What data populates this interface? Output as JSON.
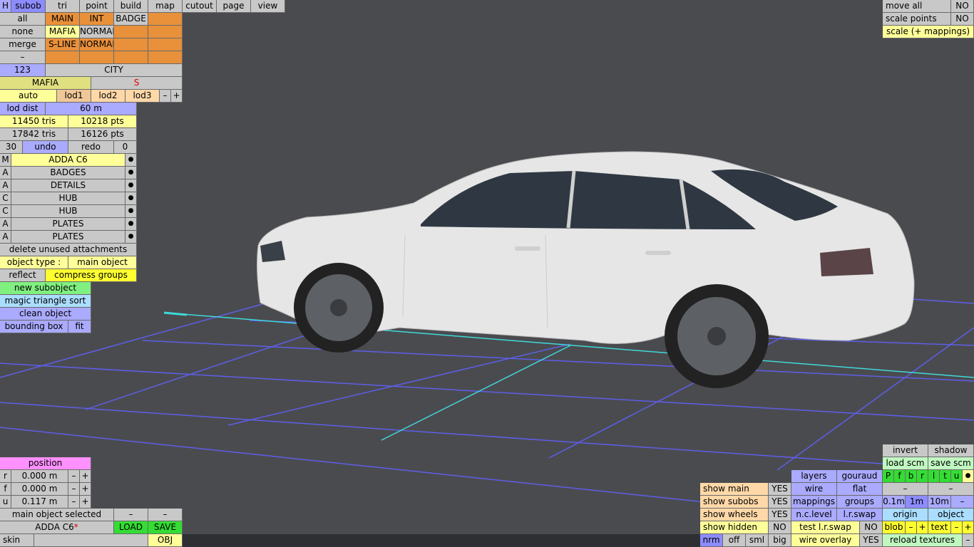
{
  "top_menu": [
    "H",
    "subob",
    "tri",
    "point",
    "build",
    "map",
    "cutout",
    "page",
    "view"
  ],
  "variants": {
    "row1": [
      "all",
      "MAIN",
      "INT",
      "BADGE"
    ],
    "row2": [
      "none",
      "MAFIA",
      "NORMAL"
    ],
    "row3": [
      "merge",
      "S-LINE",
      "NORMAL"
    ],
    "row4": [
      "–"
    ]
  },
  "number_row": {
    "num": "123",
    "name": "CITY"
  },
  "mafia_row": {
    "left": "MAFIA",
    "right": "S"
  },
  "lod": {
    "auto": "auto",
    "l1": "lod1",
    "l2": "lod2",
    "l3": "lod3",
    "minus": "–",
    "plus": "+"
  },
  "lod_dist": {
    "label": "lod dist",
    "value": "60 m"
  },
  "stats": {
    "tris1": "11450 tris",
    "pts1": "10218 pts",
    "tris2": "17842 tris",
    "pts2": "16126 pts"
  },
  "undo": {
    "count": "30",
    "undo": "undo",
    "redo": "redo",
    "redo_count": "0"
  },
  "objects": [
    {
      "type": "M",
      "name": "ADDA C6",
      "dot": "●"
    },
    {
      "type": "A",
      "name": "BADGES",
      "dot": "●"
    },
    {
      "type": "A",
      "name": "DETAILS",
      "dot": "●"
    },
    {
      "type": "C",
      "name": "HUB",
      "dot": "●"
    },
    {
      "type": "C",
      "name": "HUB",
      "dot": "●"
    },
    {
      "type": "A",
      "name": "PLATES",
      "dot": "●"
    },
    {
      "type": "A",
      "name": "PLATES",
      "dot": "●"
    }
  ],
  "actions": {
    "delete_unused": "delete unused attachments",
    "object_type_label": "object type :",
    "object_type_value": "main object",
    "reflect": "reflect",
    "compress": "compress groups",
    "new_subobject": "new subobject",
    "magic_sort": "magic triangle sort",
    "clean_object": "clean object",
    "bounding_box": "bounding box",
    "fit": "fit"
  },
  "top_right": {
    "move_all": "move all",
    "move_all_val": "NO",
    "scale_points": "scale points",
    "scale_points_val": "NO",
    "scale_mappings": "scale (+ mappings)"
  },
  "position": {
    "title": "position",
    "rows": [
      {
        "axis": "r",
        "value": "0.000 m"
      },
      {
        "axis": "f",
        "value": "0.000 m"
      },
      {
        "axis": "u",
        "value": "0.117 m"
      }
    ],
    "minus": "–",
    "plus": "+"
  },
  "bottom_left": {
    "selected": "main object selected",
    "dash1": "–",
    "dash2": "–",
    "file": "ADDA C6",
    "file_mark": "*",
    "load": "LOAD",
    "save": "SAVE",
    "skin": "skin",
    "obj": "OBJ"
  },
  "bottom_right": {
    "invert": "invert",
    "shadow": "shadow",
    "load_scm": "load scm",
    "save_scm": "save scm",
    "letters": [
      "P",
      "f",
      "b",
      "r",
      "l",
      "t",
      "u"
    ],
    "letters_dot": "●",
    "layers": "layers",
    "gouraud": "gouraud",
    "wire": "wire",
    "flat": "flat",
    "mappings": "mappings",
    "groups": "groups",
    "ncl": "n.c.level",
    "lrswap": "l.r.swap",
    "test_lrswap": "test l.r.swap",
    "test_lrswap_val": "NO",
    "wire_overlay": "wire overlay",
    "wire_overlay_val": "YES",
    "dash": "–",
    "dash2": "–",
    "sizes": [
      "0.1m",
      "1m",
      "10m",
      "–"
    ],
    "origin": "origin",
    "object": "object",
    "blob": "blob",
    "text": "text",
    "minus": "–",
    "plus": "+",
    "reload": "reload textures",
    "show": [
      {
        "label": "show main",
        "val": "YES"
      },
      {
        "label": "show subobs",
        "val": "YES"
      },
      {
        "label": "show wheels",
        "val": "YES"
      },
      {
        "label": "show hidden",
        "val": "NO"
      }
    ],
    "nrm": "nrm",
    "off": "off",
    "sml": "sml",
    "big": "big"
  }
}
